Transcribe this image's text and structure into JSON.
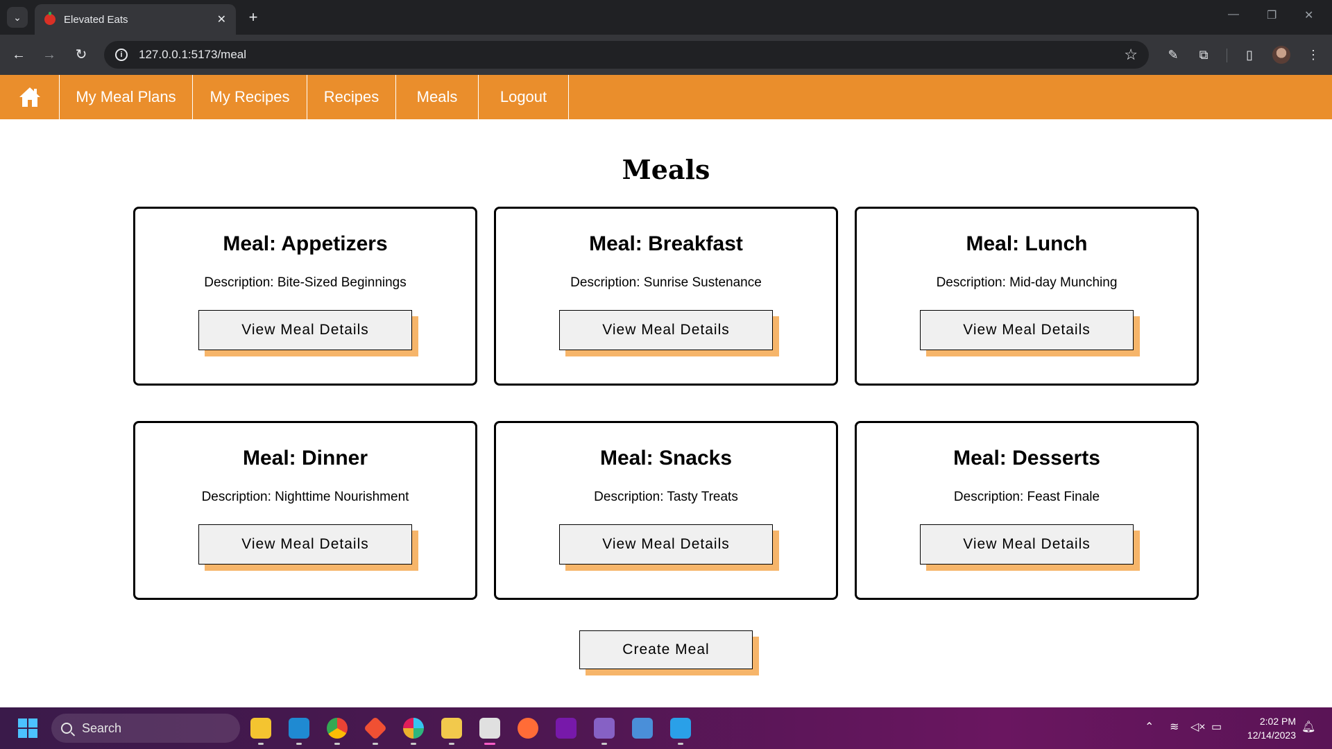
{
  "browser": {
    "tab_title": "Elevated Eats",
    "tab_close": "✕",
    "new_tab": "+",
    "url": "127.0.0.1:5173/meal"
  },
  "nav": {
    "items": [
      {
        "label": "My Meal Plans"
      },
      {
        "label": "My Recipes"
      },
      {
        "label": "Recipes"
      },
      {
        "label": "Meals"
      },
      {
        "label": "Logout"
      }
    ]
  },
  "page": {
    "title": "Meals",
    "cards": [
      {
        "title": "Meal: Appetizers",
        "description": "Description: Bite-Sized Beginnings",
        "button": "View Meal Details"
      },
      {
        "title": "Meal: Breakfast",
        "description": "Description: Sunrise Sustenance",
        "button": "View Meal Details"
      },
      {
        "title": "Meal: Lunch",
        "description": "Description: Mid-day Munching",
        "button": "View Meal Details"
      },
      {
        "title": "Meal: Dinner",
        "description": "Description: Nighttime Nourishment",
        "button": "View Meal Details"
      },
      {
        "title": "Meal: Snacks",
        "description": "Description: Tasty Treats",
        "button": "View Meal Details"
      },
      {
        "title": "Meal: Desserts",
        "description": "Description: Feast Finale",
        "button": "View Meal Details"
      }
    ],
    "create_button": "Create Meal"
  },
  "taskbar": {
    "search_placeholder": "Search",
    "time": "2:02 PM",
    "date": "12/14/2023"
  },
  "colors": {
    "nav_bg": "#ea8e2c",
    "button_shadow": "#f6b56a",
    "button_bg": "#f0f0f0"
  }
}
